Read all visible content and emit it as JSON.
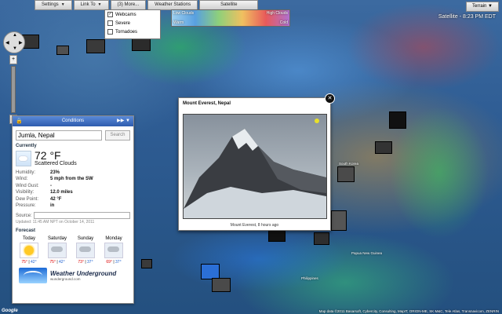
{
  "toolbar": {
    "settings": "Settings",
    "link_to": "Link To",
    "more": "(3) More...",
    "weather_stations": "Weather Stations",
    "satellite": "Satellite",
    "terrain": "Terrain"
  },
  "layers_menu": [
    {
      "label": "Webcams",
      "checked": true
    },
    {
      "label": "Severe",
      "checked": false
    },
    {
      "label": "Tornadoes",
      "checked": false
    }
  ],
  "legend": {
    "left_top": "Low Clouds",
    "right_top": "High Clouds",
    "left_bottom": "Warm",
    "right_bottom": "Cold"
  },
  "satellite_label": "Satellite - 8:23 PM EDT",
  "map_labels": {
    "south_korea": "South Korea",
    "philippines": "Philippines",
    "papua": "Papua New Guinea"
  },
  "conditions_panel": {
    "title": "Conditions",
    "location_value": "Jumla, Nepal",
    "search_label": "Search",
    "current_heading": "Currently",
    "temperature": "72 °F",
    "condition": "Scattered Clouds",
    "details": [
      {
        "label": "Humidity:",
        "value": "23%"
      },
      {
        "label": "Wind:",
        "value": "5 mph from the SW"
      },
      {
        "label": "Wind Gust:",
        "value": "-"
      },
      {
        "label": "Visibility:",
        "value": "12.0 miles"
      },
      {
        "label": "Dew Point:",
        "value": "42 °F"
      },
      {
        "label": "Pressure:",
        "value": "in"
      }
    ],
    "source_label": "Source:",
    "updated": "Updated: 11:45 AM NPT on October 14, 2011",
    "forecast_heading": "Forecast",
    "forecast": [
      {
        "day": "Today",
        "hi": "75°",
        "lo": "42°",
        "icon": "sun-icon"
      },
      {
        "day": "Saturday",
        "hi": "75°",
        "lo": "42°",
        "icon": "thunderstorm-icon"
      },
      {
        "day": "Sunday",
        "hi": "73°",
        "lo": "37°",
        "icon": "thunderstorm-icon"
      },
      {
        "day": "Monday",
        "hi": "69°",
        "lo": "37°",
        "icon": "thunderstorm-icon"
      }
    ],
    "brand_name": "Weather Underground",
    "brand_url": "wunderground.com"
  },
  "webcam_popup": {
    "title": "Mount Everest, Nepal",
    "caption": "Mount Everest, 8 hours ago"
  },
  "footer": {
    "google": "Google",
    "copyright": "Map data ©2011 Basarsoft, Cybercity, Consulting, MapIT, ORION-ME, SK M&C, Tele Atlas, Transnavicom, ZENRIN"
  },
  "colors": {
    "panel_header": "#2e5cae",
    "hi_temp": "#dd0000",
    "lo_temp": "#1a5fd0"
  }
}
